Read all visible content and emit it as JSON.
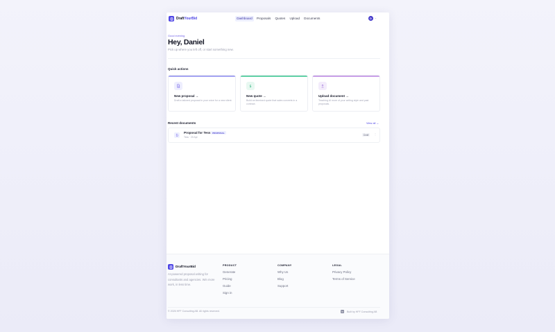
{
  "nav": {
    "brand_part1": "Draft",
    "brand_part2": "YourBid",
    "links": [
      "Dashboard",
      "Proposals",
      "Quotes",
      "Upload",
      "Documents"
    ],
    "avatar_initial": "D",
    "caret": "⌄"
  },
  "hero": {
    "greeting": "Good evening",
    "title": "Hey, Daniel",
    "subtitle": "Pick up where you left off, or start something new."
  },
  "quick_actions": {
    "title": "Quick actions",
    "cards": [
      {
        "title": "New proposal →",
        "description": "Draft a tailored proposal in your voice for a new client.",
        "accent": "#a5a4f2",
        "icon": "document-icon"
      },
      {
        "title": "New quote →",
        "description": "Build an itemised quote that sales converts in a contract.",
        "accent": "#62d2a6",
        "icon": "dollar-icon"
      },
      {
        "title": "Upload document →",
        "description": "Teaching AI more of your writing style and past proposals.",
        "accent": "#c9a0e8",
        "icon": "upload-icon"
      }
    ]
  },
  "recent": {
    "title": "Recent documents",
    "view_all": "View all →",
    "documents": [
      {
        "name": "Proposal for Tess",
        "badge": "PROPOSAL",
        "meta": "Tess · 20 Apr",
        "status": "Draft",
        "menu": "⋮"
      }
    ]
  },
  "footer": {
    "brand": "DraftYourBid",
    "tagline": "AI-powered proposal writing for consultants and agencies. Win more work, in less time.",
    "columns": [
      {
        "heading": "PRODUCT",
        "links": [
          "Generate",
          "Pricing",
          "Guide",
          "Sign in"
        ]
      },
      {
        "heading": "COMPANY",
        "links": [
          "Why Us",
          "Blog",
          "Support"
        ]
      },
      {
        "heading": "LEGAL",
        "links": [
          "Privacy Policy",
          "Terms of Service"
        ]
      }
    ],
    "copyright": "© 2026 HFF Consulting AB. All rights reserved.",
    "built_by": "Built by HFF Consulting AB"
  },
  "colors": {
    "brand": "#4f46e5",
    "proposal_accent": "#a5a4f2",
    "quote_accent": "#62d2a6",
    "upload_accent": "#c9a0e8"
  }
}
